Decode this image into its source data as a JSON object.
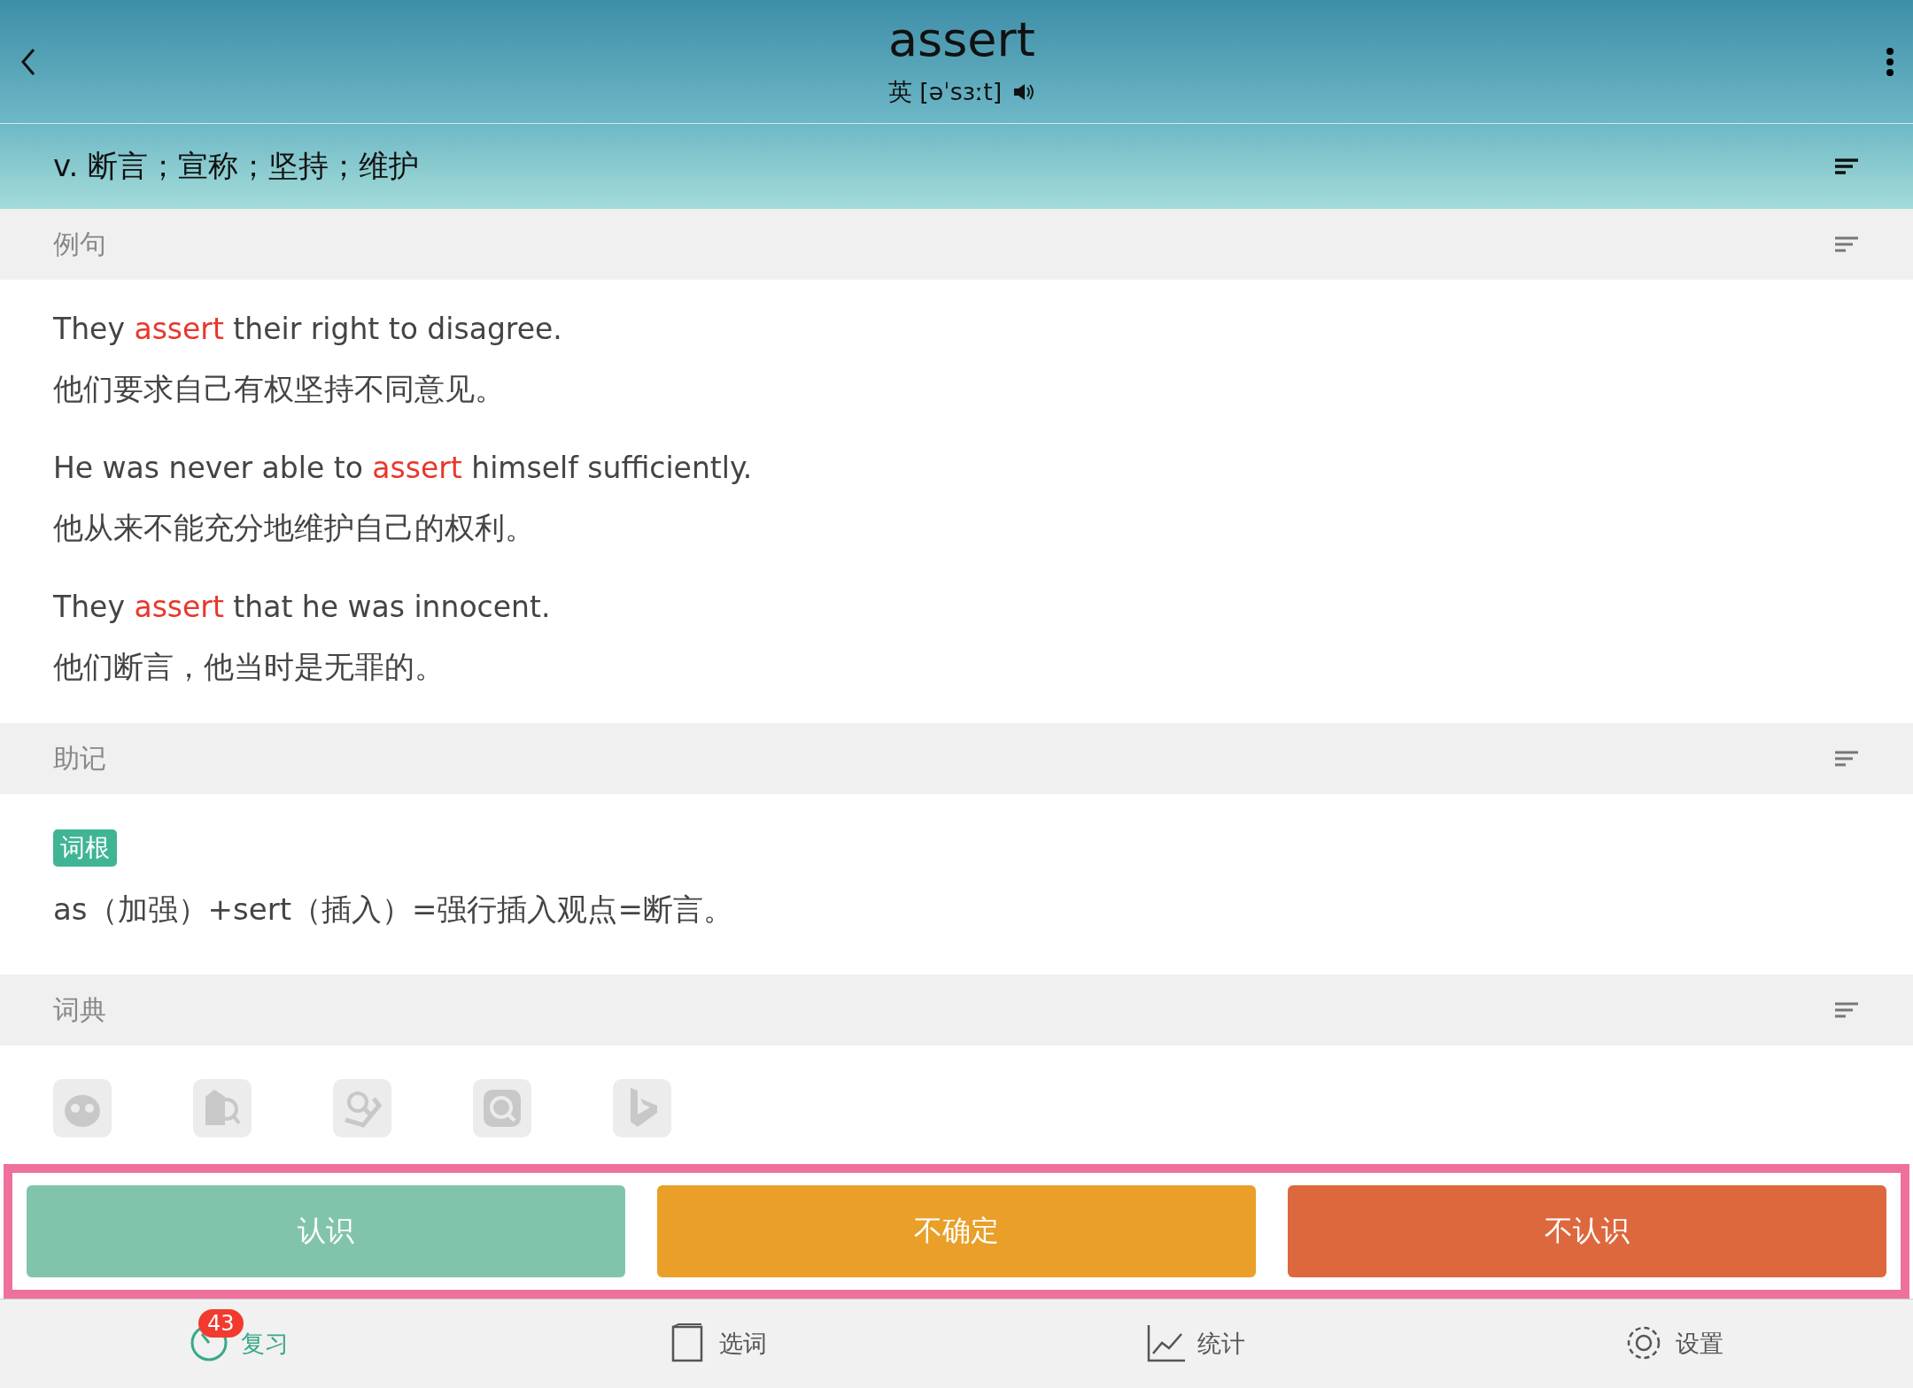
{
  "header": {
    "word": "assert",
    "phonetic": "英 [əˈsɜːt]",
    "definition": "v. 断言；宣称；坚持；维护"
  },
  "sections": [
    {
      "kind": "examples",
      "title": "例句",
      "items": [
        {
          "en": "They **assert** their right to disagree.",
          "zh": "他们要求自己有权坚持不同意见。"
        },
        {
          "en": "He was never able to **assert** himself sufficiently.",
          "zh": "他从来不能充分地维护自己的权利。"
        },
        {
          "en": "They **assert** that he was innocent.",
          "zh": "他们断言，他当时是无罪的。"
        }
      ]
    },
    {
      "kind": "mnemonic",
      "title": "助记",
      "tag": "词根",
      "text": "as（加强）+sert（插入）=强行插入观点=断言。"
    },
    {
      "kind": "dictionaries",
      "title": "词典",
      "icons": [
        {
          "kind": "owl"
        },
        {
          "kind": "book"
        },
        {
          "kind": "magnifier"
        },
        {
          "kind": "sea"
        },
        {
          "kind": "bing"
        }
      ]
    }
  ],
  "actions": [
    {
      "label": "认识",
      "color": "#82c4aa"
    },
    {
      "label": "不确定",
      "color": "#e99f28"
    },
    {
      "label": "不认识",
      "color": "#dd683d"
    }
  ],
  "tabs": [
    {
      "label": "复习",
      "selected": true,
      "kind": "clock",
      "badge": "43"
    },
    {
      "label": "选词",
      "selected": false,
      "kind": "book"
    },
    {
      "label": "统计",
      "selected": false,
      "kind": "chart"
    },
    {
      "label": "设置",
      "selected": false,
      "kind": "gear"
    }
  ]
}
